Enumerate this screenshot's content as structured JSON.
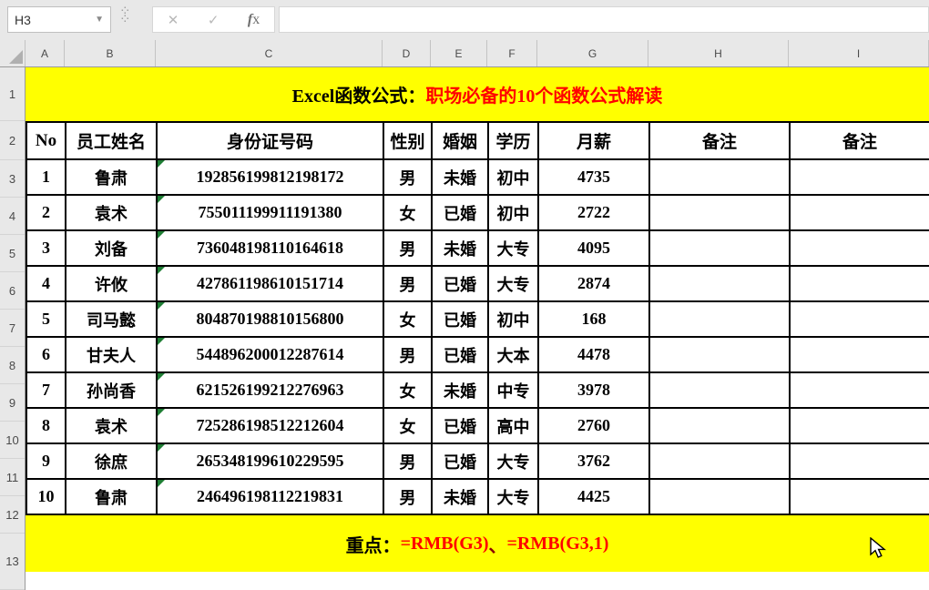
{
  "toolbar": {
    "name_box_value": "H3",
    "formula_bar_value": "",
    "cancel_icon": "✕",
    "enter_icon": "✓",
    "fx_label": "x"
  },
  "column_headers": [
    "A",
    "B",
    "C",
    "D",
    "E",
    "F",
    "G",
    "H",
    "I"
  ],
  "row_numbers": [
    "1",
    "2",
    "3",
    "4",
    "5",
    "6",
    "7",
    "8",
    "9",
    "10",
    "11",
    "12",
    "13"
  ],
  "banner_top": {
    "prefix": "Excel函数公式：",
    "highlight": "职场必备的10个函数公式解读"
  },
  "table": {
    "headers": [
      "No",
      "员工姓名",
      "身份证号码",
      "性别",
      "婚姻",
      "学历",
      "月薪",
      "备注",
      "备注"
    ],
    "rows": [
      {
        "no": "1",
        "name": "鲁肃",
        "id": "192856199812198172",
        "gender": "男",
        "marital": "未婚",
        "edu": "初中",
        "salary": "4735",
        "note1": "",
        "note2": ""
      },
      {
        "no": "2",
        "name": "袁术",
        "id": "755011199911191380",
        "gender": "女",
        "marital": "已婚",
        "edu": "初中",
        "salary": "2722",
        "note1": "",
        "note2": ""
      },
      {
        "no": "3",
        "name": "刘备",
        "id": "736048198110164618",
        "gender": "男",
        "marital": "未婚",
        "edu": "大专",
        "salary": "4095",
        "note1": "",
        "note2": ""
      },
      {
        "no": "4",
        "name": "许攸",
        "id": "427861198610151714",
        "gender": "男",
        "marital": "已婚",
        "edu": "大专",
        "salary": "2874",
        "note1": "",
        "note2": ""
      },
      {
        "no": "5",
        "name": "司马懿",
        "id": "804870198810156800",
        "gender": "女",
        "marital": "已婚",
        "edu": "初中",
        "salary": "168",
        "note1": "",
        "note2": ""
      },
      {
        "no": "6",
        "name": "甘夫人",
        "id": "544896200012287614",
        "gender": "男",
        "marital": "已婚",
        "edu": "大本",
        "salary": "4478",
        "note1": "",
        "note2": ""
      },
      {
        "no": "7",
        "name": "孙尚香",
        "id": "621526199212276963",
        "gender": "女",
        "marital": "未婚",
        "edu": "中专",
        "salary": "3978",
        "note1": "",
        "note2": ""
      },
      {
        "no": "8",
        "name": "袁术",
        "id": "725286198512212604",
        "gender": "女",
        "marital": "已婚",
        "edu": "高中",
        "salary": "2760",
        "note1": "",
        "note2": ""
      },
      {
        "no": "9",
        "name": "徐庶",
        "id": "265348199610229595",
        "gender": "男",
        "marital": "已婚",
        "edu": "大专",
        "salary": "3762",
        "note1": "",
        "note2": ""
      },
      {
        "no": "10",
        "name": "鲁肃",
        "id": "246496198112219831",
        "gender": "男",
        "marital": "未婚",
        "edu": "大专",
        "salary": "4425",
        "note1": "",
        "note2": ""
      }
    ]
  },
  "banner_bottom": {
    "prefix": "重点：",
    "formula1": "=RMB(G3)",
    "separator": "、",
    "formula2": "=RMB(G3,1)"
  },
  "colors": {
    "banner_bg": "#ffff00",
    "highlight_red": "#ff0000",
    "id_flag_green": "#1e7e34"
  }
}
